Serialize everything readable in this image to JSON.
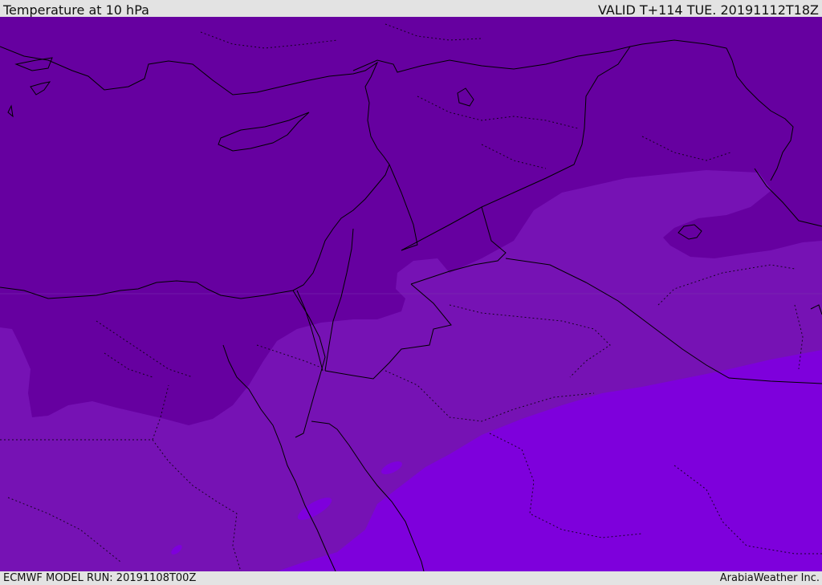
{
  "header": {
    "title": "Temperature at 10 hPa",
    "valid": "VALID T+114 TUE. 20191112T18Z"
  },
  "footer": {
    "model_run": "ECMWF MODEL RUN: 20191108T00Z",
    "credit": "ArabiaWeather Inc."
  },
  "colors": {
    "cold_band": "#6600a0",
    "mid_band": "#7612b4",
    "warm_band": "#7e00dc",
    "background": "#e3e3e3",
    "boundaries": "#000000"
  }
}
